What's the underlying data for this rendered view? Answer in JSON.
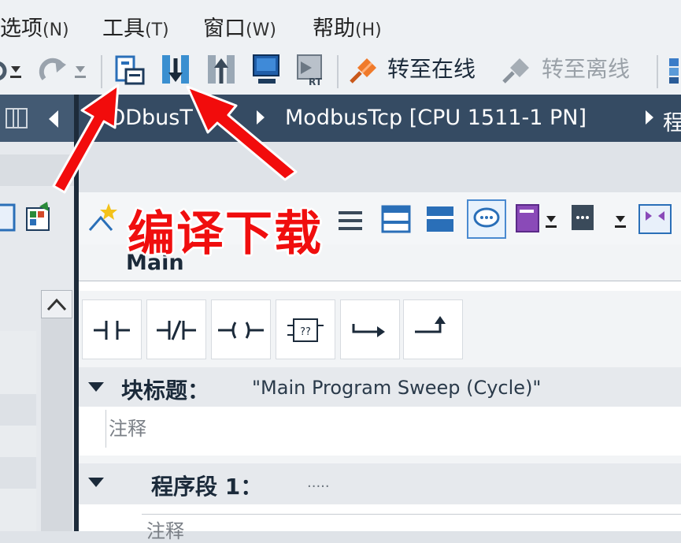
{
  "menu": {
    "items": [
      {
        "label": "选项",
        "accel": "(N)"
      },
      {
        "label": "工具",
        "accel": "(T)"
      },
      {
        "label": "窗口",
        "accel": "(W)"
      },
      {
        "label": "帮助",
        "accel": "(H)"
      }
    ]
  },
  "toolbar": {
    "go_online": "转至在线",
    "go_offline": "转至离线"
  },
  "breadcrumb": {
    "project": "ODbusT",
    "device": "ModbusTcp [CPU 1511-1 PN]",
    "next": "程"
  },
  "editor": {
    "tab": "Main",
    "block_title_label": "块标题：",
    "block_title_value": "\"Main Program Sweep (Cycle)\"",
    "block_comment": "注释",
    "network_label": "程序段 1：",
    "network_dots": ".....",
    "network_comment": "注释"
  },
  "annotation": {
    "text": "编译下载",
    "color": "#f00e0e"
  }
}
